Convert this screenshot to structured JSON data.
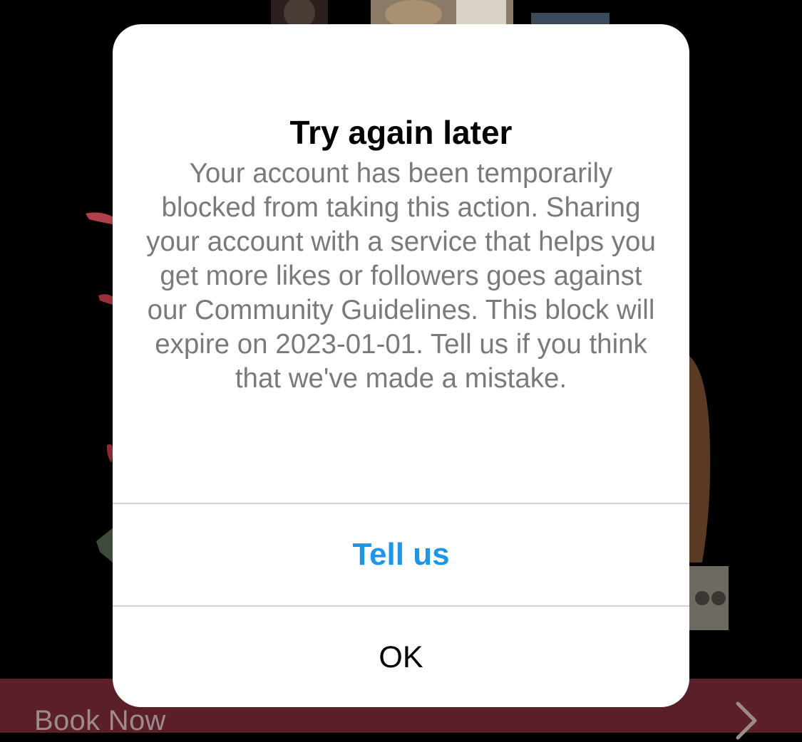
{
  "background": {
    "cta_label": "Book Now",
    "cta_icon": "chevron-right-icon",
    "bar_color": "#5a1f28"
  },
  "alert": {
    "title": "Try again later",
    "message": "Your account has been temporarily blocked from taking this action. Sharing your account with a service that helps you get more likes or followers goes against our Community Guidelines. This block will expire on 2023-01-01. Tell us if you think that we've made a mistake.",
    "primary_action": "Tell us",
    "secondary_action": "OK",
    "accent_color": "#1a97ea"
  }
}
